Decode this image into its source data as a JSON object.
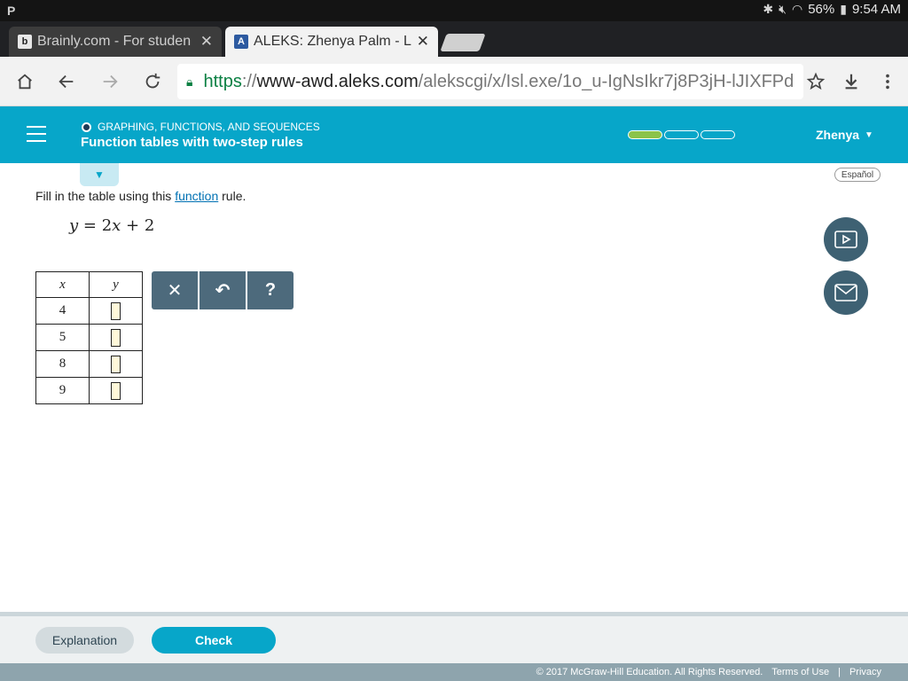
{
  "status_bar": {
    "left_icon": "P",
    "battery": "56%",
    "time": "9:54 AM",
    "icons": [
      "bluetooth-icon",
      "mute-icon",
      "wifi-icon",
      "battery-icon"
    ]
  },
  "browser": {
    "tabs": [
      {
        "favicon": "b",
        "title": "Brainly.com - For studen",
        "close": "✕"
      },
      {
        "favicon": "A",
        "title": "ALEKS: Zhenya Palm - L",
        "close": "✕"
      }
    ],
    "url": {
      "scheme": "https",
      "sep": "://",
      "host": "www-awd.aleks.com",
      "path": "/alekscgi/x/Isl.exe/1o_u-IgNsIkr7j8P3jH-lJIXFPd"
    }
  },
  "header": {
    "topic": "GRAPHING, FUNCTIONS, AND SEQUENCES",
    "lesson": "Function tables with two-step rules",
    "progress": {
      "filled_segments": 1,
      "total_segments": 3,
      "fill_color": "#8bc34a"
    },
    "user": "Zhenya",
    "accent_color": "#07a6c9"
  },
  "content": {
    "language_link": "Español",
    "prompt_before": "Fill in the table using this ",
    "prompt_link": "function",
    "prompt_after": " rule.",
    "equation": {
      "lhs": "y",
      "eq": " = 2",
      "var": "x",
      "rest": " + 2"
    },
    "table": {
      "headers": [
        "x",
        "y"
      ],
      "rows": [
        {
          "x": "4",
          "y": ""
        },
        {
          "x": "5",
          "y": ""
        },
        {
          "x": "8",
          "y": ""
        },
        {
          "x": "9",
          "y": ""
        }
      ]
    },
    "tools": {
      "clear": "✕",
      "undo": "↶",
      "help": "?"
    }
  },
  "footer": {
    "explanation": "Explanation",
    "check": "Check",
    "copyright": "© 2017 McGraw-Hill Education. All Rights Reserved.",
    "terms": "Terms of Use",
    "separator": "|",
    "privacy": "Privacy"
  }
}
